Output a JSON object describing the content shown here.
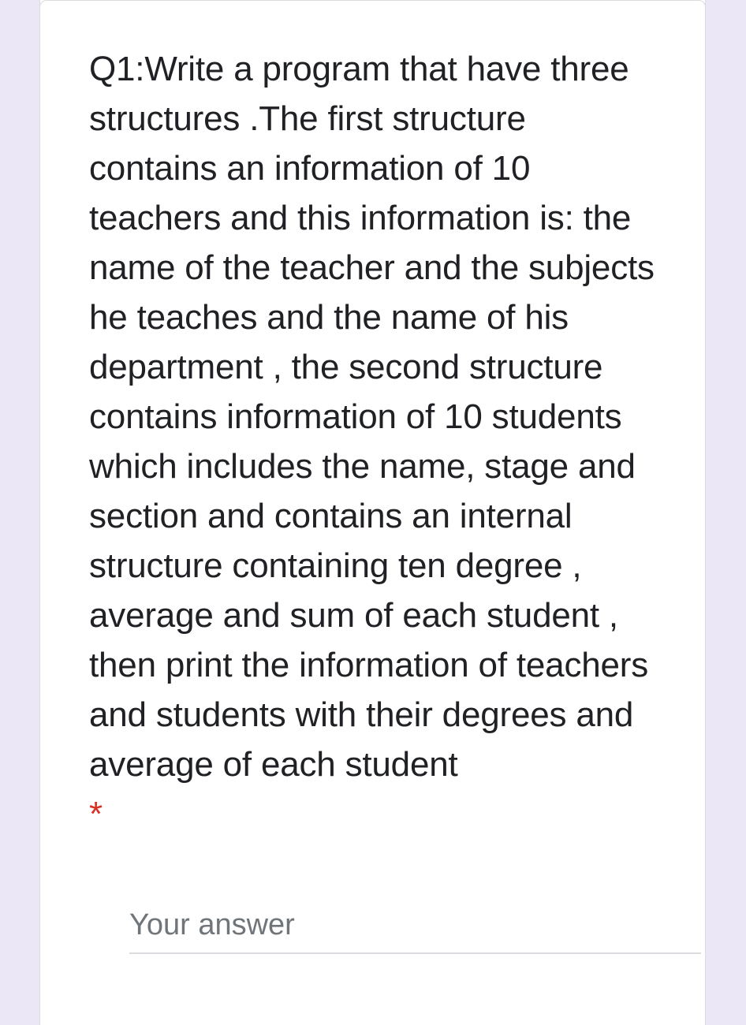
{
  "theme": {
    "page_background": "#ebe7f6",
    "card_background": "#ffffff",
    "text_color": "#202124",
    "required_marker_color": "#d93025",
    "placeholder_color": "#70757a",
    "underline_color": "#dadce0"
  },
  "question": {
    "text": "Q1:Write a program that have three structures .The first structure contains an information of 10 teachers and this information is: the name of the teacher and the subjects he teaches and the name of his department , the second structure contains information of 10 students which includes the name, stage and section and contains an internal structure containing ten degree , average and sum of each student , then print the information of teachers and students with their degrees and average of each student",
    "required_marker": "*",
    "lines": [
      "Q1:Write a program that have three",
      "structures .The first structure",
      "contains an information of 10",
      "teachers and this information is: the",
      "name of the teacher and the subjects",
      "he teaches and the name of his",
      "department , the second structure",
      "contains information of 10 students",
      "which includes the name, stage and",
      "section and contains an internal",
      "structure containing ten degree ,",
      "average and sum of each student ,",
      "then print the information of",
      "teachers and students with their",
      "degrees and average of each student",
      "*"
    ]
  },
  "answer": {
    "placeholder": "Your answer",
    "value": ""
  }
}
